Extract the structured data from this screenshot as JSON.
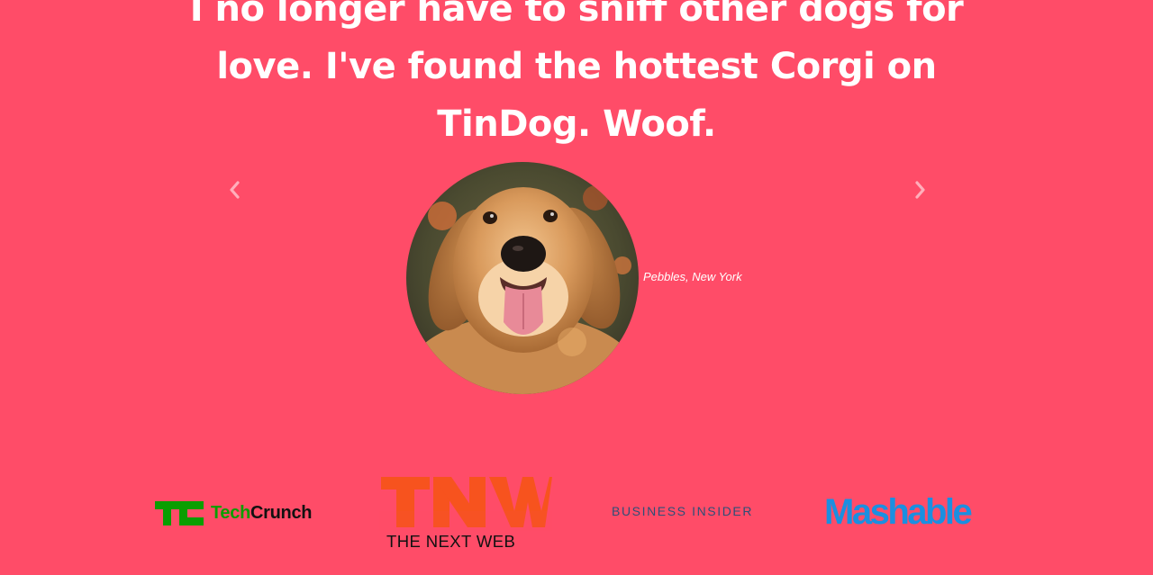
{
  "testimonial": {
    "quote": "I no longer have to sniff other dogs for love. I've found the hottest Corgi on TinDog. Woof.",
    "author": "Pebbles, New York",
    "image_subject": "golden-retriever-dog"
  },
  "carousel": {
    "prev_icon": "chevron-left-icon",
    "next_icon": "chevron-right-icon"
  },
  "press": {
    "techcrunch": {
      "tech": "Tech",
      "crunch": "Crunch",
      "brand_color": "#0a9e01"
    },
    "tnw": {
      "name": "THE NEXT WEB",
      "brand_color": "#f7531e"
    },
    "business_insider": {
      "name": "BUSINESS INSIDER",
      "brand_color": "#2d4f78"
    },
    "mashable": {
      "name": "Mashable",
      "brand_color": "#1b8fe0"
    }
  },
  "colors": {
    "background": "#ff4c68",
    "text": "#ffffff"
  }
}
